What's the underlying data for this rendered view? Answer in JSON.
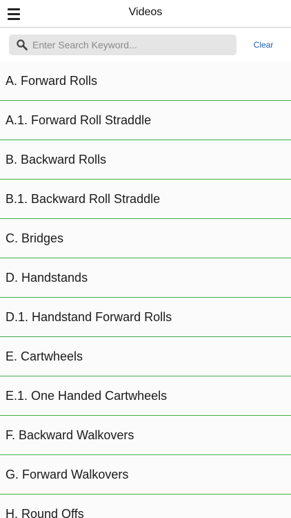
{
  "navbar": {
    "title": "Videos",
    "menu_icon": "hamburger-menu-icon"
  },
  "search": {
    "placeholder": "Enter Search Keyword...",
    "value": "",
    "icon": "search-icon",
    "clear_label": "Clear"
  },
  "colors": {
    "divider": "#3fae4a",
    "link": "#1d5fb8",
    "search_bg": "#e5e5e5"
  },
  "videos": [
    {
      "label": "A. Forward Rolls"
    },
    {
      "label": "A.1. Forward Roll Straddle"
    },
    {
      "label": "B. Backward Rolls"
    },
    {
      "label": "B.1. Backward Roll Straddle"
    },
    {
      "label": "C. Bridges"
    },
    {
      "label": "D. Handstands"
    },
    {
      "label": "D.1. Handstand Forward Rolls"
    },
    {
      "label": "E. Cartwheels"
    },
    {
      "label": "E.1. One Handed Cartwheels"
    },
    {
      "label": "F. Backward Walkovers"
    },
    {
      "label": "G. Forward Walkovers"
    },
    {
      "label": "H. Round Offs"
    }
  ]
}
